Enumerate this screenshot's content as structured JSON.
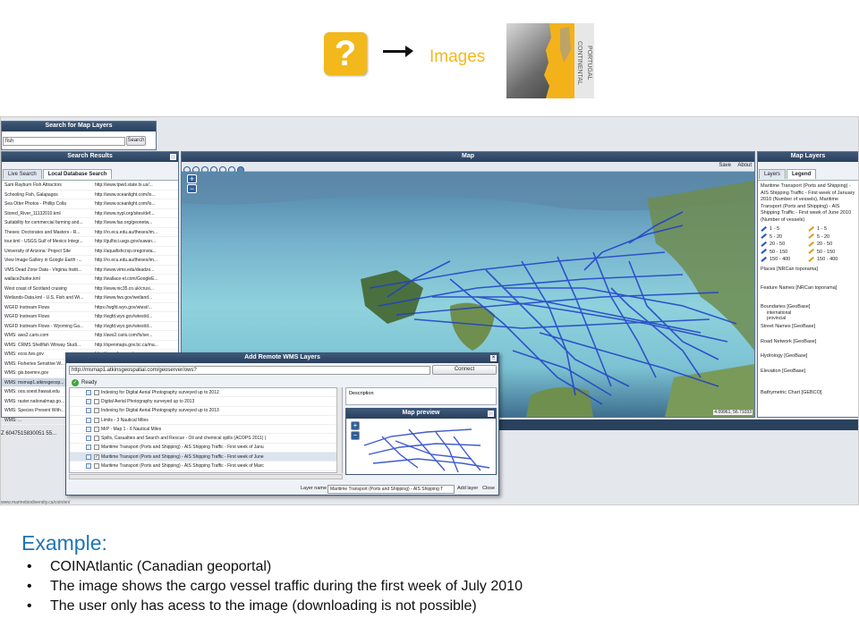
{
  "header": {
    "question_mark": "?",
    "images_label": "Images",
    "thumbnail_label": "PORTUGAL CONTINENTAL"
  },
  "search": {
    "title": "Search for Map Layers",
    "query": "fish",
    "button": "Search"
  },
  "results": {
    "title": "Search Results",
    "tabs": [
      "Live Search",
      "Local Database Search"
    ],
    "rows": [
      [
        "Sam Rayburn Fish Attractors",
        "http://www.tpwd.state.tx.us/..."
      ],
      [
        "Schooling Fish, Galapagos",
        "http://www.oceanlight.com/lo..."
      ],
      [
        "Sea Otter Photos - Phillip Colla",
        "http://www.oceanlight.com/lo..."
      ],
      [
        "Stored_River_11132010.kml",
        "http://www.nypl.org/sites/def..."
      ],
      [
        "Suitability for commercial farming and...",
        "http://www.fao.org/geonetw..."
      ],
      [
        "Theses: Doctorates and Masters - R...",
        "http://ro.ecu.edu.au/theses/im..."
      ],
      [
        "tour.kml - USGS Gulf of Mexico Integr...",
        "http://gulfsci.usgs.gov/suwan..."
      ],
      [
        "University of Arizona: Project Site",
        "http://aquafishcrsp.oregonsta..."
      ],
      [
        "View Image Gallery in Google Earth -...",
        "http://ro.ecu.edu.au/theses/im..."
      ],
      [
        "VMS Dead Zone Data - Virginia Instit...",
        "http://www.vims.edu/deadzo..."
      ],
      [
        "wallace2turke.kml",
        "http://wallace-el.com/GoogleE..."
      ],
      [
        "West coast of Scotland cruising",
        "http://www.nic35.co.uk/crusi..."
      ],
      [
        "Wetlands-Data.kml - U.S. Fish and Wi...",
        "http://www.fws.gov/wetland..."
      ],
      [
        "WGFD Instream Flows",
        "https://wgfd.wyo.gov/wtest/..."
      ],
      [
        "WGFD Instream Flows",
        "http://wgfd.wyo.gov/wtest/d..."
      ],
      [
        "WGFD Instream Flows - Wyoming Ga...",
        "http://wgfd.wyo.gov/wtest/d..."
      ],
      [
        "WMS: aws2.caris.com",
        "http://aws2.caris.com/fs/ser..."
      ],
      [
        "WMS: CRMS Shellfish Wtrway Studi...",
        "http://openmaps.gov.bc.ca/ma..."
      ],
      [
        "WMS: ecos.fws.gov",
        "http://ecos.fws.gov/geoserve..."
      ],
      [
        "WMS: Fisheries Sensitive W...",
        ""
      ],
      [
        "WMS: gis.boemre.gov",
        ""
      ],
      [
        "WMS: msmap1.atkinsgeosp...",
        ""
      ],
      [
        "WMS: oos.soest.hawaii.edu",
        ""
      ],
      [
        "WMS: raster.nationalmap.go...",
        ""
      ],
      [
        "WMS: Species Present With...",
        ""
      ],
      [
        "WMS: ...",
        ""
      ]
    ],
    "coords": "Z 6047515830051 55..."
  },
  "map": {
    "title": "Map",
    "save": "Save",
    "about": "About",
    "coord_readout": "4.09961, 56.71033",
    "zoom_in": "+",
    "zoom_out": "−"
  },
  "layers": {
    "title": "Map Layers",
    "tabs": [
      "Layers",
      "Legend"
    ],
    "legend_title": "Maritime Transport (Ports and Shipping) - AIS Shipping Traffic - First week of January 2010 (Number of vessels), Maritime Transport (Ports and Shipping) - AIS Shipping Traffic - First week of June 2010 (Number of vessels)",
    "ranges_left": [
      "1 - 5",
      "5 - 20",
      "20 - 50",
      "50 - 150",
      "150 - 400"
    ],
    "ranges_right": [
      "1 - 5",
      "5 - 20",
      "20 - 50",
      "50 - 150",
      "150 - 400"
    ],
    "places": "Places [NRCan toporama]",
    "feature_names": "Feature Names [NRCan toporama]",
    "boundaries": "Boundaries [GeoBase]",
    "international": "international",
    "provincial": "provincial",
    "street_names": "Street Names [GeoBase]",
    "road_network": "Road Network [GeoBase]",
    "hydrology": "Hydrology [GeoBase]",
    "elevation": "Elevation [GeoBase]",
    "bathymetric": "Bathymetric Chart [GEBCO]"
  },
  "wms": {
    "title": "Add Remote WMS Layers",
    "url": "http://msmap1.atkinsgeospatial.com/geoserver/ows?",
    "connect": "Connect",
    "status": "Ready",
    "description_label": "Description",
    "preview_title": "Map preview",
    "items": [
      {
        "label": "Indexing for Digital Aerial Photography surveyed up to 2012",
        "checked": false
      },
      {
        "label": "Digital Aerial Photography surveyed up to 2013",
        "checked": false
      },
      {
        "label": "Indexing for Digital Aerial Photography surveyed up to 2013",
        "checked": false
      },
      {
        "label": "Limits - 3 Nautical Miles",
        "checked": false
      },
      {
        "label": "MrP - Map 1 - 6 Nautical Miles",
        "checked": false
      },
      {
        "label": "Spills, Casualties and Search and Rescue - Oil and chemical spills (ACOPS 2011) (",
        "checked": false
      },
      {
        "label": "Maritime Transport (Ports and Shipping) - AIS Shipping Traffic - First week of Janu",
        "checked": false
      },
      {
        "label": "Maritime Transport (Ports and Shipping) - AIS Shipping Traffic - First week of June",
        "checked": true
      },
      {
        "label": "Maritime Transport (Ports and Shipping) - AIS Shipping Traffic - First week of Marc",
        "checked": false
      }
    ],
    "layer_name_label": "Layer name",
    "layer_name_value": "Maritime Transport (Ports and Shipping) - AIS Shipping T",
    "add_layer": "Add layer",
    "close": "Close"
  },
  "footer_url": "www.marinebiodiversity.ca/coin/en/",
  "slide": {
    "heading": "Example:",
    "bullets": [
      "COINAtlantic (Canadian geoportal)",
      "The image shows the cargo vessel traffic during the first week of July 2010",
      "The user only has acess to the image  (downloading is not possible)"
    ]
  }
}
